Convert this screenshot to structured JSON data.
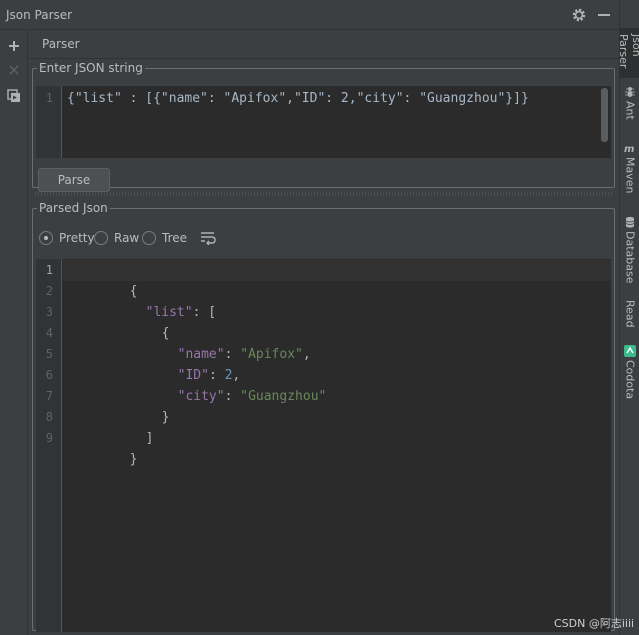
{
  "window": {
    "title": "Json Parser"
  },
  "tab": {
    "label": "Parser"
  },
  "input_group": {
    "legend": "Enter JSON string",
    "line_numbers": [
      "1"
    ],
    "value": "{\"list\" : [{\"name\": \"Apifox\",\"ID\": 2,\"city\": \"Guangzhou\"}]}",
    "parse_label": "Parse"
  },
  "output_group": {
    "legend": "Parsed Json",
    "options": {
      "pretty": "Pretty",
      "raw": "Raw",
      "tree": "Tree"
    },
    "selected": "Pretty",
    "line_numbers": [
      "1",
      "2",
      "3",
      "4",
      "5",
      "6",
      "7",
      "8",
      "9"
    ],
    "code": {
      "l1": "{",
      "l2_key": "\"list\"",
      "l2_rest": ": [",
      "l3": "{",
      "l4_key": "\"name\"",
      "l4_colon": ": ",
      "l4_val": "\"Apifox\"",
      "l4_comma": ",",
      "l5_key": "\"ID\"",
      "l5_colon": ": ",
      "l5_val": "2",
      "l5_comma": ",",
      "l6_key": "\"city\"",
      "l6_colon": ": ",
      "l6_val": "\"Guangzhou\"",
      "l7": "}",
      "l8": "]",
      "l9": "}"
    }
  },
  "right_tabs": {
    "json_parser": "Json Parser",
    "ant": "Ant",
    "maven": "Maven",
    "database": "Database",
    "read": "Read",
    "codota": "Codota"
  },
  "watermark": "CSDN @阿志iiii",
  "colors": {
    "background": "#3c3f41",
    "editor": "#2b2b2b",
    "key": "#9876aa",
    "string": "#6a8759",
    "number": "#6897bb",
    "codota": "#3dba8c"
  },
  "icons": [
    "gear-icon",
    "minimize-icon",
    "add-icon",
    "close-icon",
    "copy-icon",
    "soft-wrap-icon",
    "ant-icon",
    "maven-icon",
    "database-icon",
    "codota-icon"
  ]
}
